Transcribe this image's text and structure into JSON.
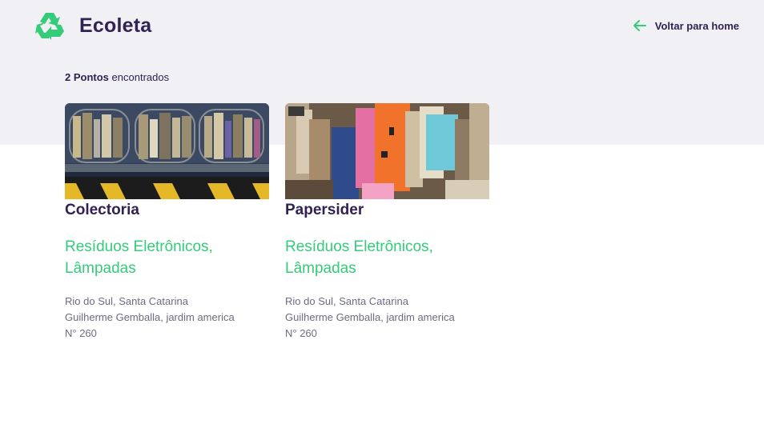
{
  "header": {
    "app_name": "Ecoleta",
    "logo_icon": "recycle-icon",
    "back_label": "Voltar para home",
    "back_icon": "arrow-left-icon",
    "brand_color": "#34cb79"
  },
  "results": {
    "count_label": "2 Pontos",
    "suffix_label": "encontrados"
  },
  "points": [
    {
      "name": "Colectoria",
      "items_line1": "Resíduos Eletrônicos,",
      "items_line2": "Lâmpadas",
      "city_uf": "Rio do Sul, Santa Catarina",
      "street": "Guilherme Gemballa, jardim america",
      "number": "N° 260"
    },
    {
      "name": "Papersider",
      "items_line1": "Resíduos Eletrônicos,",
      "items_line2": "Lâmpadas",
      "city_uf": "Rio do Sul, Santa Catarina",
      "street": "Guilherme Gemballa, jardim america",
      "number": "N° 260"
    }
  ]
}
